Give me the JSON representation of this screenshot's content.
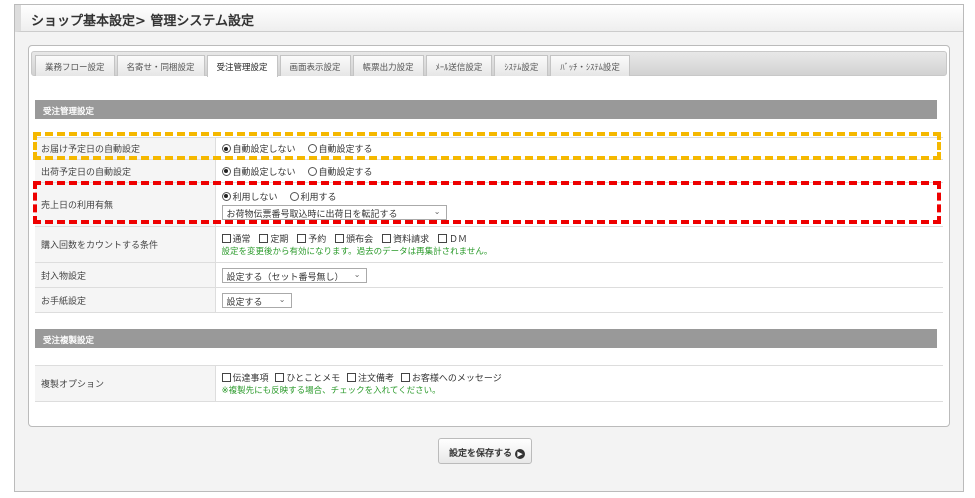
{
  "title": "ショップ基本設定> 管理システム設定",
  "tabs": [
    "業務フロー設定",
    "名寄せ・同梱設定",
    "受注管理設定",
    "画面表示設定",
    "帳票出力設定",
    "ﾒｰﾙ送信設定",
    "ｼｽﾃﾑ設定",
    "ﾊﾞｯﾁ・ｼｽﾃﾑ設定"
  ],
  "active_tab": "受注管理設定",
  "section1": {
    "title": "受注管理設定",
    "rows": [
      {
        "label": "お届け予定日の自動設定",
        "options": [
          "自動設定しない",
          "自動設定する"
        ],
        "selected": 0
      },
      {
        "label": "出荷予定日の自動設定",
        "options": [
          "自動設定しない",
          "自動設定する"
        ],
        "selected": 0
      },
      {
        "label": "売上日の利用有無",
        "options": [
          "利用しない",
          "利用する"
        ],
        "selected": 0,
        "select_value": "お荷物伝票番号取込時に出荷日を転記する"
      },
      {
        "label": "購入回数をカウントする条件",
        "checks": [
          "通常",
          "定期",
          "予約",
          "頒布会",
          "資料請求",
          "ＤＭ"
        ],
        "note": "設定を変更後から有効になります。過去のデータは再集計されません。"
      },
      {
        "label": "封入物設定",
        "select_value": "設定する（セット番号無し）"
      },
      {
        "label": "お手紙設定",
        "select_value": "設定する"
      }
    ]
  },
  "section2": {
    "title": "受注複製設定",
    "label": "複製オプション",
    "checks": [
      "伝達事項",
      "ひとことメモ",
      "注文備考",
      "お客様へのメッセージ"
    ],
    "note": "※複製先にも反映する場合、チェックを入れてください。"
  },
  "save_label": "設定を保存する"
}
